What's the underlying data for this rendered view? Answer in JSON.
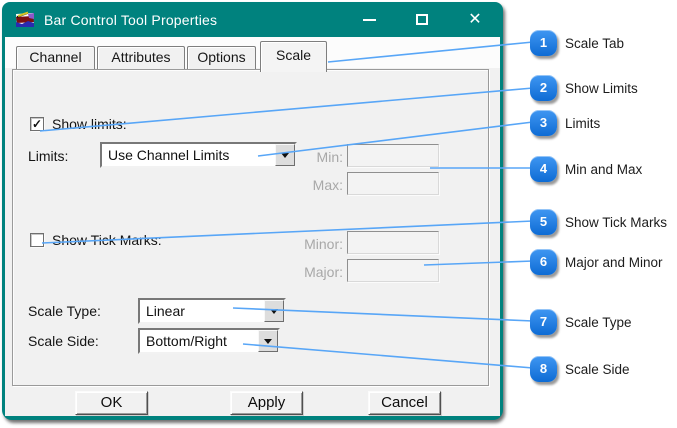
{
  "window": {
    "title": "Bar Control Tool Properties",
    "icon": "bar-chart-app-icon",
    "controls": {
      "minimize": "minimize-icon",
      "maximize": "maximize-icon",
      "close": "✕"
    }
  },
  "tabs": [
    {
      "label": "Channel",
      "active": false
    },
    {
      "label": "Attributes",
      "active": false
    },
    {
      "label": "Options",
      "active": false
    },
    {
      "label": "Scale",
      "active": true
    }
  ],
  "scale_panel": {
    "show_limits": {
      "label": "Show limits:",
      "checked": true,
      "check_glyph": "✓"
    },
    "limits": {
      "label": "Limits:",
      "value": "Use Channel Limits"
    },
    "min": {
      "label": "Min:",
      "value": "",
      "disabled": true
    },
    "max": {
      "label": "Max:",
      "value": "",
      "disabled": true
    },
    "show_tick_marks": {
      "label": "Show Tick Marks:",
      "checked": false,
      "check_glyph": ""
    },
    "minor": {
      "label": "Minor:",
      "value": "",
      "disabled": true
    },
    "major": {
      "label": "Major:",
      "value": "",
      "disabled": true
    },
    "scale_type": {
      "label": "Scale Type:",
      "value": "Linear"
    },
    "scale_side": {
      "label": "Scale Side:",
      "value": "Bottom/Right"
    }
  },
  "buttons": {
    "ok": "OK",
    "apply": "Apply",
    "cancel": "Cancel"
  },
  "callouts": [
    {
      "number": "1",
      "label": "Scale Tab"
    },
    {
      "number": "2",
      "label": "Show Limits"
    },
    {
      "number": "3",
      "label": "Limits"
    },
    {
      "number": "4",
      "label": "Min and Max"
    },
    {
      "number": "5",
      "label": "Show Tick Marks"
    },
    {
      "number": "6",
      "label": "Major and Minor"
    },
    {
      "number": "7",
      "label": "Scale Type"
    },
    {
      "number": "8",
      "label": "Scale Side"
    }
  ],
  "colors": {
    "titlebar_teal": "#00827E",
    "badge_blue": "#1779E3",
    "line_blue": "#58A6F7",
    "dialog_bg": "#F1F1F1"
  }
}
